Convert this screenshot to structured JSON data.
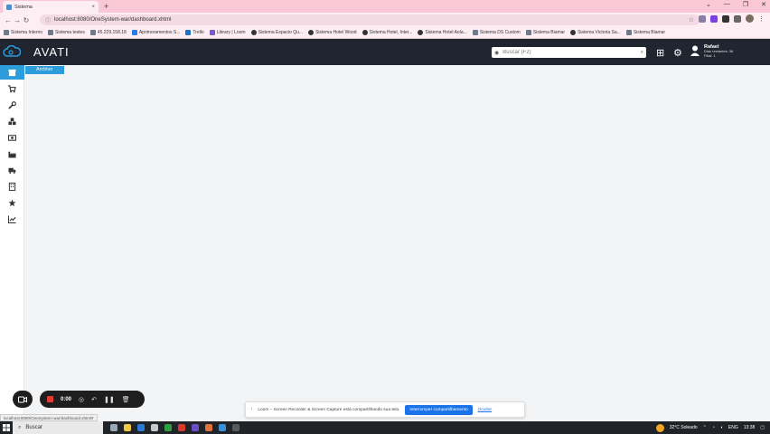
{
  "browser": {
    "tab_title": "Sistema",
    "tab_close": "×",
    "new_tab": "+",
    "window_controls": [
      "⌄",
      "—",
      "❐",
      "✕"
    ],
    "url": "localhost:8080/OneSystem-war/dashboard.xhtml",
    "status_url": "localhost:8080/OneSystem-war/dashboard.xhtml#"
  },
  "bookmarks": [
    {
      "label": "Sistema Interno",
      "icon": "grid"
    },
    {
      "label": "Sistema testes",
      "icon": "grid"
    },
    {
      "label": "45.229.158.18",
      "icon": "grid"
    },
    {
      "label": "Aprimoramentos S...",
      "icon": "blue"
    },
    {
      "label": "Trello",
      "icon": "trello"
    },
    {
      "label": "Library | Loom",
      "icon": "purple"
    },
    {
      "label": "Sistema Espacio Qu...",
      "icon": "dot"
    },
    {
      "label": "Sistema Hotel Wood",
      "icon": "dot"
    },
    {
      "label": "Sistema Hotel, Inter...",
      "icon": "dot"
    },
    {
      "label": "Sistema Hotel Aola...",
      "icon": "dot"
    },
    {
      "label": "Sistema DS Custom",
      "icon": "grid"
    },
    {
      "label": "Sistema Biamar",
      "icon": "grid"
    },
    {
      "label": "Sistema Victoria Sa...",
      "icon": "dot"
    },
    {
      "label": "Sistema Biamar",
      "icon": "grid"
    }
  ],
  "header": {
    "logo_text": "AVATI",
    "search_placeholder": "Buscar (F2)",
    "user_name": "Rafael",
    "user_meta_1": "Dias restantes: 36",
    "user_meta_2": "Filial: 1"
  },
  "sidebar": {
    "archive_label": "Archivo",
    "items": [
      "archive",
      "cart",
      "wrench",
      "cubes",
      "money",
      "factory",
      "truck",
      "building",
      "star",
      "chart"
    ]
  },
  "loom": {
    "time": "0:00"
  },
  "share_bar": {
    "message": "Loom – Screen Recorder & Screen Capture está compartilhando sua tela.",
    "stop_label": "Interromper compartilhamento",
    "hide_label": "Ocultar"
  },
  "taskbar": {
    "search_label": "Buscar",
    "weather": "32°C  Soleado",
    "lang": "ENG",
    "time": "13:38"
  }
}
